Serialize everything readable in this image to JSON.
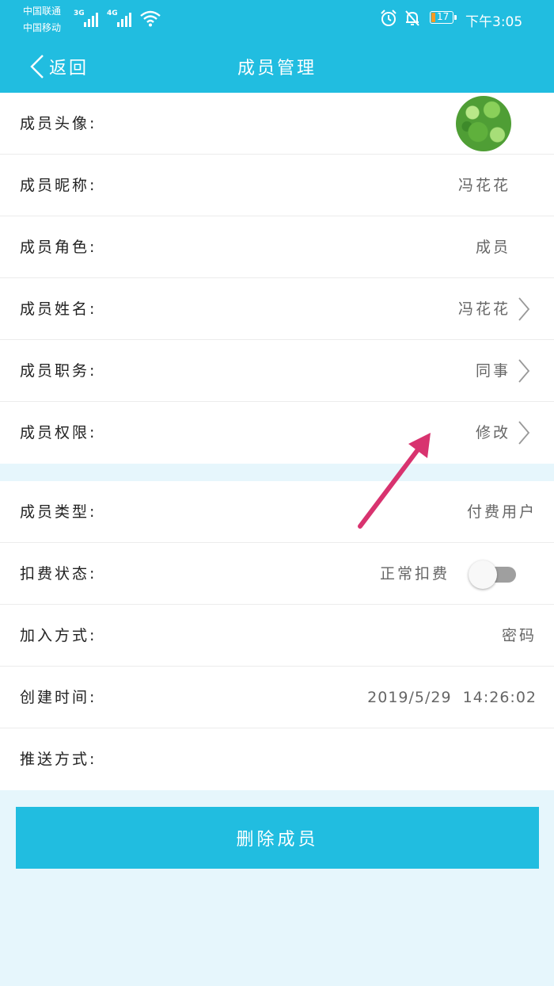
{
  "status_bar": {
    "carrier_1": "中国联通",
    "carrier_2": "中国移动",
    "signal_1_tag": "3G",
    "signal_2_tag": "4G",
    "battery_level": "17",
    "time": "下午3:05",
    "icons": [
      "signal-icon",
      "wifi-icon",
      "alarm-icon",
      "mute-bell-icon",
      "battery-icon"
    ]
  },
  "nav": {
    "back_label": "返回",
    "title": "成员管理"
  },
  "section_1": [
    {
      "label": "成员头像:",
      "value": "",
      "type": "avatar"
    },
    {
      "label": "成员昵称:",
      "value": "冯花花",
      "type": "text"
    },
    {
      "label": "成员角色:",
      "value": "成员",
      "type": "text"
    },
    {
      "label": "成员姓名:",
      "value": "冯花花",
      "type": "link"
    },
    {
      "label": "成员职务:",
      "value": "同事",
      "type": "link"
    },
    {
      "label": "成员权限:",
      "value": "修改",
      "type": "link"
    }
  ],
  "section_2": [
    {
      "label": "成员类型:",
      "value": "付费用户",
      "type": "text"
    },
    {
      "label": "扣费状态:",
      "value": "正常扣费",
      "type": "toggle",
      "toggle_on": false
    },
    {
      "label": "加入方式:",
      "value": "密码",
      "type": "text"
    },
    {
      "label": "创建时间:",
      "value": "2019/5/29  14:26:02",
      "type": "text"
    },
    {
      "label": "推送方式:",
      "value": "",
      "type": "text"
    }
  ],
  "delete_button": "删除成员",
  "colors": {
    "accent": "#21bde0",
    "page_bg": "#e6f6fc",
    "annotation_arrow": "#d8336f"
  }
}
